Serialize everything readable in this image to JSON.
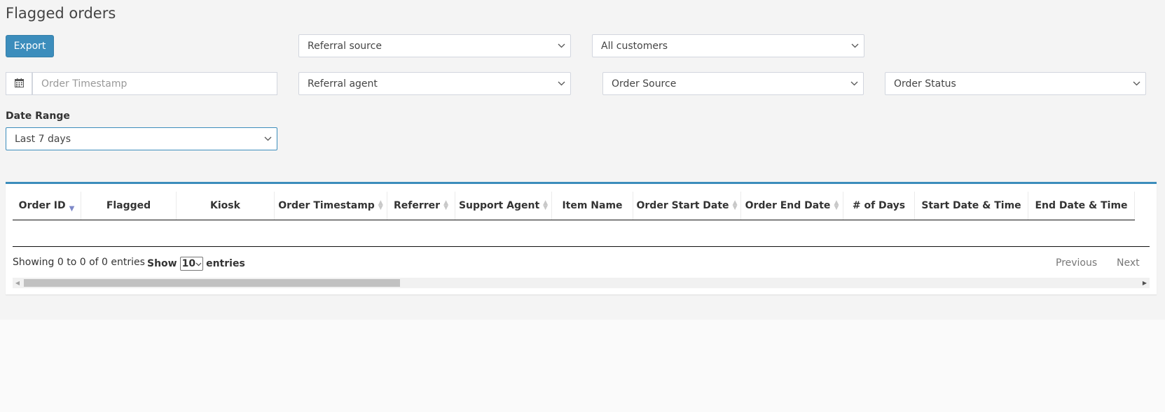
{
  "page": {
    "title": "Flagged orders"
  },
  "toolbar": {
    "export_label": "Export"
  },
  "filters": {
    "referral_source": "Referral source",
    "customers": "All customers",
    "order_timestamp_placeholder": "Order Timestamp",
    "referral_agent": "Referral agent",
    "order_source": "Order Source",
    "order_status": "Order Status",
    "date_range_label": "Date Range",
    "date_range_value": "Last 7 days"
  },
  "table": {
    "columns": [
      {
        "label": "Order ID",
        "sort": "desc"
      },
      {
        "label": "Flagged",
        "sort": "none"
      },
      {
        "label": "Kiosk",
        "sort": "none"
      },
      {
        "label": "Order Timestamp",
        "sort": "both"
      },
      {
        "label": "Referrer",
        "sort": "both"
      },
      {
        "label": "Support Agent",
        "sort": "both"
      },
      {
        "label": "Item Name",
        "sort": "none"
      },
      {
        "label": "Order Start Date",
        "sort": "both"
      },
      {
        "label": "Order End Date",
        "sort": "both"
      },
      {
        "label": "# of Days",
        "sort": "none"
      },
      {
        "label": "Start Date & Time",
        "sort": "none"
      },
      {
        "label": "End Date & Time",
        "sort": "none"
      }
    ],
    "rows": []
  },
  "footer": {
    "info": "Showing 0 to 0 of 0 entries",
    "show_label": "Show",
    "page_length": "10",
    "entries_label": "entries",
    "previous_label": "Previous",
    "next_label": "Next"
  },
  "icons": {
    "calendar": "calendar-icon",
    "chevron": "chevron-down-icon",
    "sort": "sort-icon"
  },
  "colors": {
    "accent": "#3c8dbc",
    "sort_active": "#7d88c8"
  }
}
